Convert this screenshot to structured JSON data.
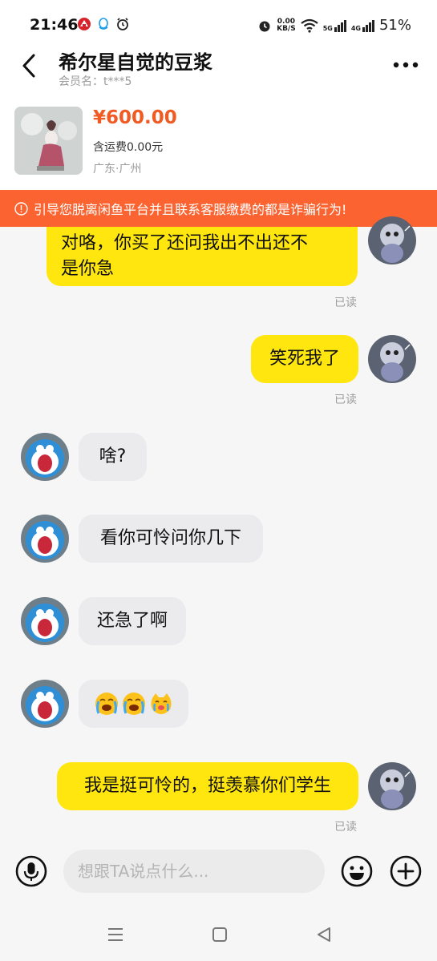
{
  "status_bar": {
    "time": "21:46",
    "net_speed_value": "0.00",
    "net_speed_unit": "KB/S",
    "signal_5g": "5G",
    "signal_4g": "4G",
    "battery": "51%"
  },
  "header": {
    "title": "希尔星自觉的豆浆",
    "subtitle": "会员名：t***5"
  },
  "product": {
    "price": "¥600.00",
    "shipping": "含运费0.00元",
    "location": "广东·广州"
  },
  "warning": {
    "text": "引导您脱离闲鱼平台并且联系客服缴费的都是诈骗行为!"
  },
  "messages": [
    {
      "sender": "me",
      "text": "对咯，你买了还问我出不出还不是你急",
      "line1": "对咯，你买了还问我出不出还不",
      "line2": "是你急",
      "status": "已读"
    },
    {
      "sender": "me",
      "text": "笑死我了",
      "status": "已读"
    },
    {
      "sender": "them",
      "text": "啥?"
    },
    {
      "sender": "them",
      "text": "看你可怜问你几下"
    },
    {
      "sender": "them",
      "text": "还急了啊"
    },
    {
      "sender": "them",
      "emojis": [
        "loudly-crying-face",
        "loudly-crying-face",
        "crying-cat-face"
      ]
    },
    {
      "sender": "me",
      "text": "我是挺可怜的，挺羡慕你们学生",
      "status": "已读"
    }
  ],
  "input": {
    "placeholder": "想跟TA说点什么..."
  },
  "colors": {
    "accent_yellow": "#ffe60f",
    "warning_orange": "#fb6331",
    "price_red": "#f05a23",
    "their_bubble": "#ebebee"
  }
}
